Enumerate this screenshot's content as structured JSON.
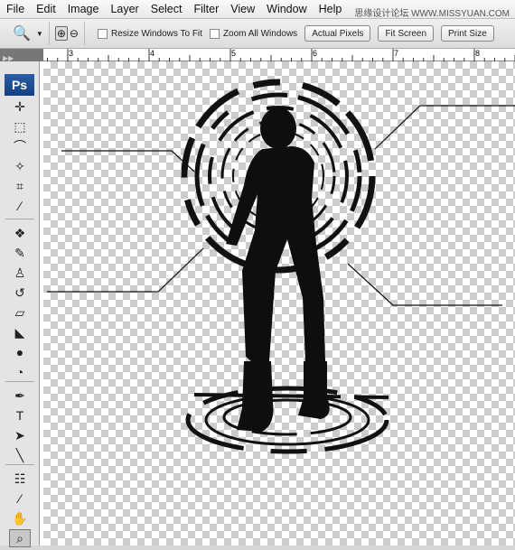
{
  "menu": [
    "File",
    "Edit",
    "Image",
    "Layer",
    "Select",
    "Filter",
    "View",
    "Window",
    "Help"
  ],
  "watermark": "思缘设计论坛 WWW.MISSYUAN.COM",
  "options": {
    "resize_label": "Resize Windows To Fit",
    "zoom_all_label": "Zoom All Windows",
    "actual_pixels": "Actual Pixels",
    "fit_screen": "Fit Screen",
    "print_size": "Print Size"
  },
  "ruler": [
    "3",
    "4",
    "5",
    "6",
    "7",
    "8"
  ],
  "toolbox": {
    "logo": "Ps",
    "tools": [
      "move",
      "marquee",
      "lasso",
      "magic-wand",
      "crop",
      "slice",
      "healing-brush",
      "brush",
      "clone-stamp",
      "history-brush",
      "eraser",
      "paint-bucket",
      "blur",
      "dodge",
      "pen",
      "type",
      "path-selection",
      "line",
      "notes",
      "eyedropper",
      "hand",
      "zoom"
    ]
  }
}
